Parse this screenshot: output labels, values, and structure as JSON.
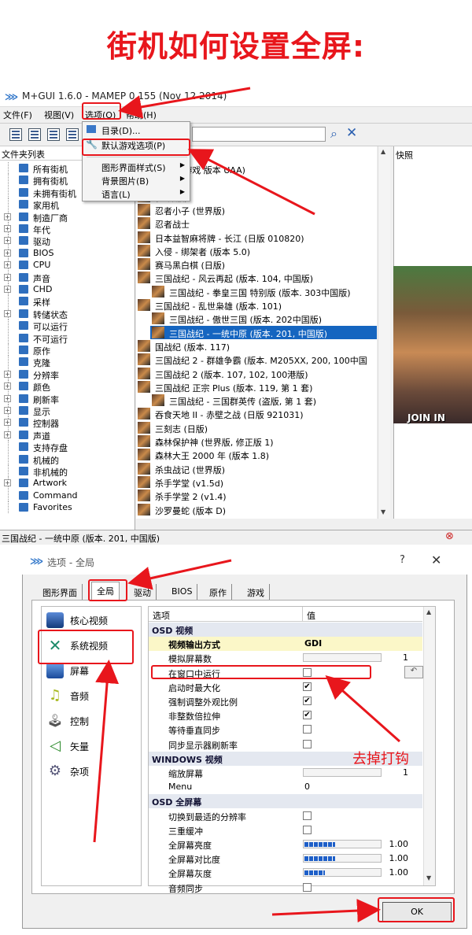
{
  "heading": "街机如何设置全屏:",
  "w1": {
    "title": "M+GUI 1.6.0 - MAMEP 0.155 (Nov 12 2014)",
    "menus": [
      "文件(F)",
      "视图(V)",
      "选项(O)",
      "帮助(H)"
    ],
    "folder_header": "文件夹列表",
    "folders": [
      {
        "label": "所有街机",
        "pm": ""
      },
      {
        "label": "拥有街机",
        "pm": ""
      },
      {
        "label": "未拥有街机",
        "pm": ""
      },
      {
        "label": "家用机",
        "pm": ""
      },
      {
        "label": "制造厂商",
        "pm": "+"
      },
      {
        "label": "年代",
        "pm": "+"
      },
      {
        "label": "驱动",
        "pm": "+"
      },
      {
        "label": "BIOS",
        "pm": "+"
      },
      {
        "label": "CPU",
        "pm": "+"
      },
      {
        "label": "声音",
        "pm": "+"
      },
      {
        "label": "CHD",
        "pm": "+"
      },
      {
        "label": "采样",
        "pm": ""
      },
      {
        "label": "转储状态",
        "pm": "+"
      },
      {
        "label": "可以运行",
        "pm": ""
      },
      {
        "label": "不可运行",
        "pm": ""
      },
      {
        "label": "原作",
        "pm": ""
      },
      {
        "label": "克隆",
        "pm": ""
      },
      {
        "label": "分辨率",
        "pm": "+"
      },
      {
        "label": "颜色",
        "pm": "+"
      },
      {
        "label": "刷新率",
        "pm": "+"
      },
      {
        "label": "显示",
        "pm": "+"
      },
      {
        "label": "控制器",
        "pm": "+"
      },
      {
        "label": "声道",
        "pm": "+"
      },
      {
        "label": "支持存盘",
        "pm": ""
      },
      {
        "label": "机械的",
        "pm": ""
      },
      {
        "label": "非机械的",
        "pm": ""
      },
      {
        "label": "Artwork",
        "pm": "+"
      },
      {
        "label": "Command",
        "pm": ""
      },
      {
        "label": "Favorites",
        "pm": ""
      }
    ],
    "games": [
      {
        "label": "2 (4 人游戏 版本 UAA)",
        "indent": 0
      },
      {
        "label": "",
        "indent": 0
      },
      {
        "label": "(世界版)",
        "indent": 0
      },
      {
        "label": "忍者小子 (世界版)",
        "indent": 0
      },
      {
        "label": "忍者战士",
        "indent": 0
      },
      {
        "label": "日本益智麻将牌 - 长江 (日版 010820)",
        "indent": 0
      },
      {
        "label": "入侵 - 绑架者 (版本 5.0)",
        "indent": 0
      },
      {
        "label": "赛马黑白棋 (日版)",
        "indent": 0
      },
      {
        "label": "三国战纪 - 风云再起 (版本. 104, 中国版)",
        "indent": 0
      },
      {
        "label": "三国战纪 - 拳皇三国 特别版 (版本. 303中国版)",
        "indent": 1
      },
      {
        "label": "三国战纪 - 乱世枭雄 (版本. 101)",
        "indent": 0
      },
      {
        "label": "三国战纪 - 傲世三国 (版本. 202中国版)",
        "indent": 1
      },
      {
        "label": "三国战纪 - 一统中原 (版本. 201, 中国版)",
        "indent": 1
      },
      {
        "label": "国战纪 (版本. 117)",
        "indent": 0
      },
      {
        "label": "三国战纪 2 - 群雄争霸 (版本. M205XX, 200, 100中国",
        "indent": 0
      },
      {
        "label": "三国战纪 2 (版本. 107, 102, 100港版)",
        "indent": 0
      },
      {
        "label": "三国战纪 正宗 Plus (版本. 119, 第 1 套)",
        "indent": 0
      },
      {
        "label": "三国战纪 - 三国群英传 (盗版, 第 1 套)",
        "indent": 1
      },
      {
        "label": "吞食天地 II - 赤壁之战 (日版 921031)",
        "indent": 0
      },
      {
        "label": "三刻志 (日版)",
        "indent": 0
      },
      {
        "label": "森林保护神 (世界版, 修正版 1)",
        "indent": 0
      },
      {
        "label": "森林大王 2000 年 (版本 1.8)",
        "indent": 0
      },
      {
        "label": "杀虫战记 (世界版)",
        "indent": 0
      },
      {
        "label": "杀手学堂 (v1.5d)",
        "indent": 0
      },
      {
        "label": "杀手学堂 2 (v1.4)",
        "indent": 0
      },
      {
        "label": "沙罗曼蛇 (版本 D)",
        "indent": 0
      }
    ],
    "selected_game_index": 12,
    "snapshot_label": "快照",
    "snapshot_text": "JOIN  IN",
    "status": "三国战纪 - 一统中原 (版本. 201, 中国版)"
  },
  "dropdown": {
    "items": [
      "目录(D)...",
      "默认游戏选项(P)",
      "图形界面样式(S)",
      "背景图片(B)",
      "语言(L)"
    ]
  },
  "w2": {
    "title": "选项 - 全局",
    "help": "?",
    "close": "✕",
    "tabs": [
      "图形界面",
      "全局",
      "驱动",
      "BIOS",
      "原作",
      "游戏"
    ],
    "categories": [
      "核心视频",
      "系统视频",
      "屏幕",
      "音频",
      "控制",
      "矢量",
      "杂项"
    ],
    "grid_head": {
      "option": "选项",
      "value": "值"
    },
    "rows": [
      {
        "type": "head",
        "label": "OSD 视频"
      },
      {
        "type": "text",
        "label": "视频输出方式",
        "value": "GDI",
        "highlight": true
      },
      {
        "type": "num",
        "label": "模拟屏幕数",
        "value": "1"
      },
      {
        "type": "check",
        "label": "在窗口中运行",
        "checked": false
      },
      {
        "type": "check",
        "label": "启动时最大化",
        "checked": true
      },
      {
        "type": "check",
        "label": "强制调整外观比例",
        "checked": true
      },
      {
        "type": "check",
        "label": "非整数倍拉伸",
        "checked": true
      },
      {
        "type": "check",
        "label": "等待垂直同步",
        "checked": false
      },
      {
        "type": "check",
        "label": "同步显示器刷新率",
        "checked": false
      },
      {
        "type": "head",
        "label": "WINDOWS 视频"
      },
      {
        "type": "num",
        "label": "缩放屏幕",
        "value": "1"
      },
      {
        "type": "text",
        "label": "Menu",
        "value": "0"
      },
      {
        "type": "head",
        "label": "OSD 全屏幕"
      },
      {
        "type": "check",
        "label": "切换到最适的分辨率",
        "checked": false
      },
      {
        "type": "check",
        "label": "三重缓冲",
        "checked": false
      },
      {
        "type": "slider",
        "label": "全屏幕亮度",
        "value": "1.00",
        "level": 0.4
      },
      {
        "type": "slider",
        "label": "全屏幕对比度",
        "value": "1.00",
        "level": 0.4
      },
      {
        "type": "slider",
        "label": "全屏幕灰度",
        "value": "1.00",
        "level": 0.27
      },
      {
        "type": "check",
        "label": "音频同步",
        "checked": false
      }
    ],
    "ok": "OK"
  },
  "annotation": "去掉打钩",
  "colors": {
    "accent": "#e8161c",
    "selection": "#1565c0"
  }
}
